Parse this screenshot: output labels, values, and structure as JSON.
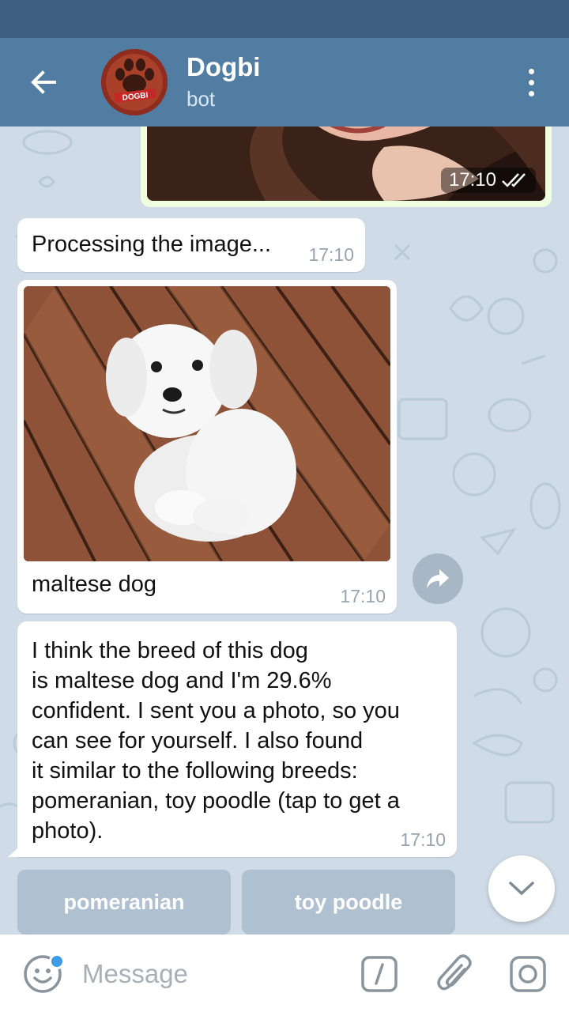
{
  "header": {
    "title": "Dogbi",
    "subtitle": "bot",
    "avatar_text": "DOGBI"
  },
  "messages": {
    "outgoing_photo_time": "17:10",
    "processing": {
      "text": "Processing the image...",
      "time": "17:10"
    },
    "photo": {
      "caption": "maltese dog",
      "time": "17:10"
    },
    "result": {
      "text": "I think the breed of this dog\nis maltese dog and I'm 29.6%\nconfident. I sent you a photo, so you\ncan see for yourself. I also found\nit similar to the following breeds:\npomeranian, toy poodle (tap to get a\nphoto).",
      "time": "17:10"
    }
  },
  "keyboard": {
    "buttons": [
      {
        "label": "pomeranian"
      },
      {
        "label": "toy poodle"
      }
    ]
  },
  "input": {
    "placeholder": "Message"
  },
  "colors": {
    "header": "#527da3",
    "status_bar": "#3e5f82",
    "chat_background": "#cfdbe6",
    "outgoing_bubble": "#eefedf",
    "incoming_bubble": "#ffffff",
    "unread_dot": "#3d9be8"
  }
}
